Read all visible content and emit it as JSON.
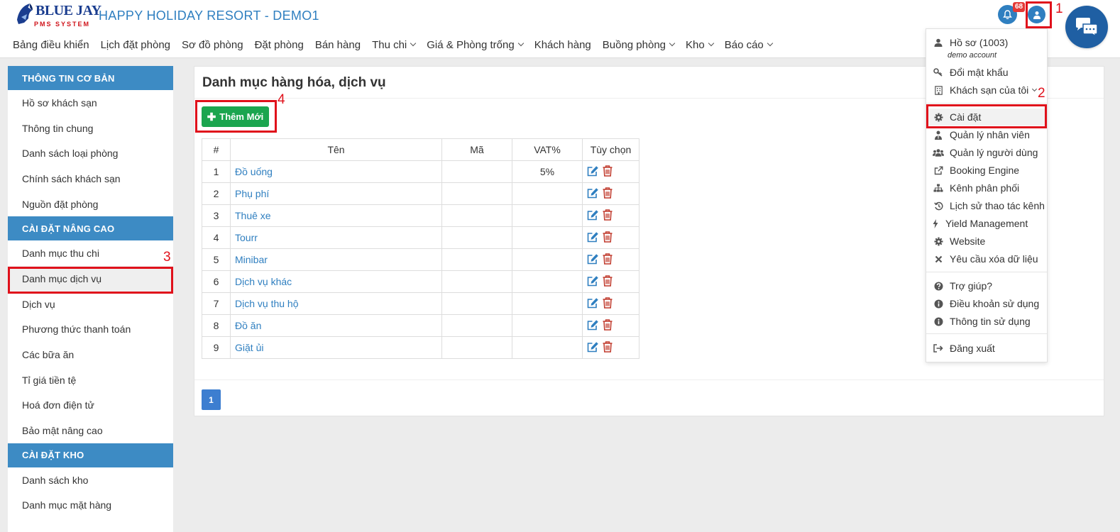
{
  "header": {
    "logo_brand": "BLUE JAY",
    "logo_sub": "PMS SYSTEM",
    "hotel_title": "HAPPY HOLIDAY RESORT - DEMO1",
    "notification_count": "68"
  },
  "nav": [
    {
      "label": "Bảng điều khiển",
      "dropdown": false
    },
    {
      "label": "Lịch đặt phòng",
      "dropdown": false
    },
    {
      "label": "Sơ đồ phòng",
      "dropdown": false
    },
    {
      "label": "Đặt phòng",
      "dropdown": false
    },
    {
      "label": "Bán hàng",
      "dropdown": false
    },
    {
      "label": "Thu chi",
      "dropdown": true
    },
    {
      "label": "Giá & Phòng trống",
      "dropdown": true
    },
    {
      "label": "Khách hàng",
      "dropdown": false
    },
    {
      "label": "Buồng phòng",
      "dropdown": true
    },
    {
      "label": "Kho",
      "dropdown": true
    },
    {
      "label": "Báo cáo",
      "dropdown": true
    }
  ],
  "sidebar": {
    "sections": [
      {
        "title": "THÔNG TIN CƠ BẢN",
        "items": [
          "Hồ sơ khách sạn",
          "Thông tin chung",
          "Danh sách loại phòng",
          "Chính sách khách sạn",
          "Nguồn đặt phòng"
        ]
      },
      {
        "title": "CÀI ĐẶT NÂNG CAO",
        "items": [
          "Danh mục thu chi",
          "Danh mục dịch vụ",
          "Dịch vụ",
          "Phương thức thanh toán",
          "Các bữa ăn",
          "Tỉ giá tiền tệ",
          "Hoá đơn điện tử",
          "Bảo mật nâng cao"
        ]
      },
      {
        "title": "CÀI ĐẶT KHO",
        "items": [
          "Danh sách kho",
          "Danh mục mặt hàng"
        ]
      }
    ],
    "active_item": "Danh mục dịch vụ"
  },
  "main": {
    "title": "Danh mục hàng hóa, dịch vụ",
    "add_button": "Thêm Mới",
    "columns": [
      "#",
      "Tên",
      "Mã",
      "VAT%",
      "Tùy chọn"
    ],
    "rows": [
      {
        "num": "1",
        "name": "Đồ uống",
        "code": "",
        "vat": "5%"
      },
      {
        "num": "2",
        "name": "Phụ phí",
        "code": "",
        "vat": ""
      },
      {
        "num": "3",
        "name": "Thuê xe",
        "code": "",
        "vat": ""
      },
      {
        "num": "4",
        "name": "Tourr",
        "code": "",
        "vat": ""
      },
      {
        "num": "5",
        "name": "Minibar",
        "code": "",
        "vat": ""
      },
      {
        "num": "6",
        "name": "Dịch vụ khác",
        "code": "",
        "vat": ""
      },
      {
        "num": "7",
        "name": "Dịch vụ thu hộ",
        "code": "",
        "vat": ""
      },
      {
        "num": "8",
        "name": "Đồ ăn",
        "code": "",
        "vat": ""
      },
      {
        "num": "9",
        "name": "Giặt ủi",
        "code": "",
        "vat": ""
      }
    ],
    "page": "1"
  },
  "user_menu": {
    "profile": "Hồ sơ  (1003)",
    "account": "demo account",
    "change_password": "Đổi mật khẩu",
    "my_hotels": "Khách sạn của tôi",
    "items": [
      {
        "label": "Cài đặt",
        "icon": "gear-icon"
      },
      {
        "label": "Quản lý nhân viên",
        "icon": "staff-icon"
      },
      {
        "label": "Quản lý người dùng",
        "icon": "users-icon"
      },
      {
        "label": "Booking Engine",
        "icon": "external-link-icon"
      },
      {
        "label": "Kênh phân phối",
        "icon": "sitemap-icon"
      },
      {
        "label": "Lịch sử thao tác kênh",
        "icon": "history-icon"
      },
      {
        "label": "Yield Management",
        "icon": "bolt-icon"
      },
      {
        "label": "Website",
        "icon": "gear-icon"
      },
      {
        "label": "Yêu cầu xóa dữ liệu",
        "icon": "times-icon"
      }
    ],
    "help": "Trợ giúp?",
    "terms": "Điều khoản sử dụng",
    "usage_info": "Thông tin sử dụng",
    "logout": "Đăng xuất"
  },
  "annotations": [
    "1",
    "2",
    "3",
    "4"
  ]
}
